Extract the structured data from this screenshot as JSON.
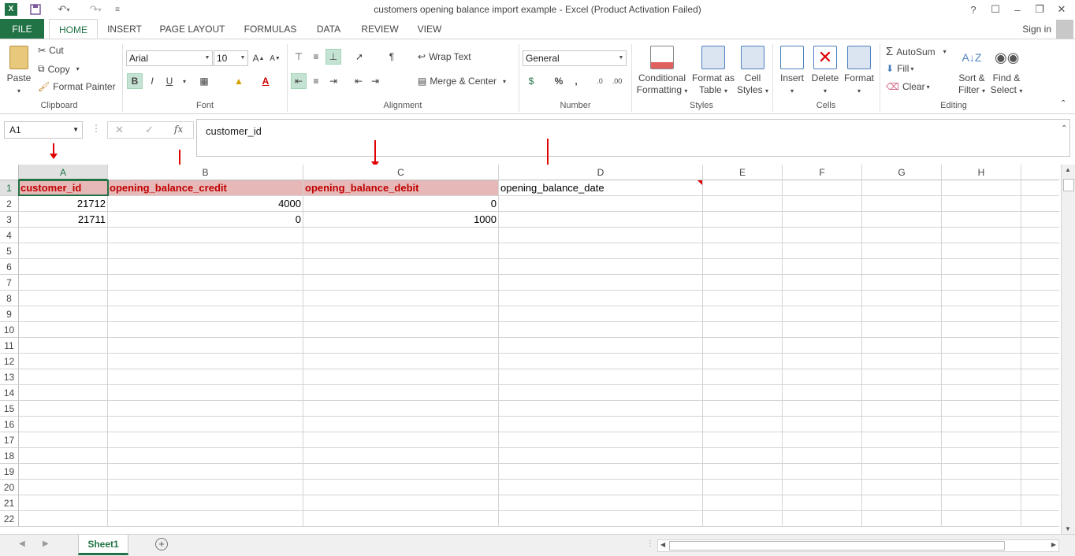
{
  "window": {
    "title": "customers opening balance import example - Excel (Product Activation Failed)",
    "help": "?",
    "controls": [
      "☐",
      "–",
      "❐",
      "✕"
    ]
  },
  "tabs": [
    {
      "label": "FILE"
    },
    {
      "label": "HOME"
    },
    {
      "label": "INSERT"
    },
    {
      "label": "PAGE LAYOUT"
    },
    {
      "label": "FORMULAS"
    },
    {
      "label": "DATA"
    },
    {
      "label": "REVIEW"
    },
    {
      "label": "VIEW"
    }
  ],
  "signin": "Sign in",
  "ribbon": {
    "clipboard": {
      "label": "Clipboard",
      "paste": "Paste",
      "cut": "Cut",
      "copy": "Copy",
      "format_painter": "Format Painter"
    },
    "font": {
      "label": "Font",
      "name": "Arial",
      "size": "10",
      "bold": "B",
      "italic": "I",
      "underline": "U"
    },
    "alignment": {
      "label": "Alignment",
      "wrap": "Wrap Text",
      "merge": "Merge & Center"
    },
    "number": {
      "label": "Number",
      "format": "General",
      "percent": "%",
      "comma": ","
    },
    "styles": {
      "label": "Styles",
      "conditional_1": "Conditional",
      "conditional_2": "Formatting",
      "format_as_1": "Format as",
      "format_as_2": "Table",
      "cell_1": "Cell",
      "cell_2": "Styles"
    },
    "cells": {
      "label": "Cells",
      "insert": "Insert",
      "delete": "Delete",
      "format": "Format"
    },
    "editing": {
      "label": "Editing",
      "autosum": "AutoSum",
      "fill": "Fill",
      "clear": "Clear",
      "sort_1": "Sort &",
      "sort_2": "Filter",
      "find_1": "Find &",
      "find_2": "Select"
    }
  },
  "formula_bar": {
    "name_box": "A1",
    "fx": "fx",
    "content": "customer_id"
  },
  "sheet": {
    "columns": [
      "A",
      "B",
      "C",
      "D",
      "E",
      "F",
      "G",
      "H"
    ],
    "rows": [
      "1",
      "2",
      "3",
      "4",
      "5",
      "6",
      "7",
      "8",
      "9",
      "10",
      "11",
      "12",
      "13",
      "14",
      "15",
      "16",
      "17",
      "18",
      "19",
      "20",
      "21",
      "22"
    ],
    "cells": {
      "A1": "customer_id",
      "B1": "opening_balance_credit",
      "C1": "opening_balance_debit",
      "D1": "opening_balance_date",
      "A2": "21712",
      "B2": "4000",
      "C2": "0",
      "A3": "21711",
      "B3": "0",
      "C3": "1000"
    }
  },
  "sheet_tabs": [
    {
      "label": "Sheet1"
    }
  ],
  "colors": {
    "accent": "#217346",
    "header_fill": "#e6b8b7",
    "header_text": "#c00000",
    "arrow": "#e00000"
  }
}
